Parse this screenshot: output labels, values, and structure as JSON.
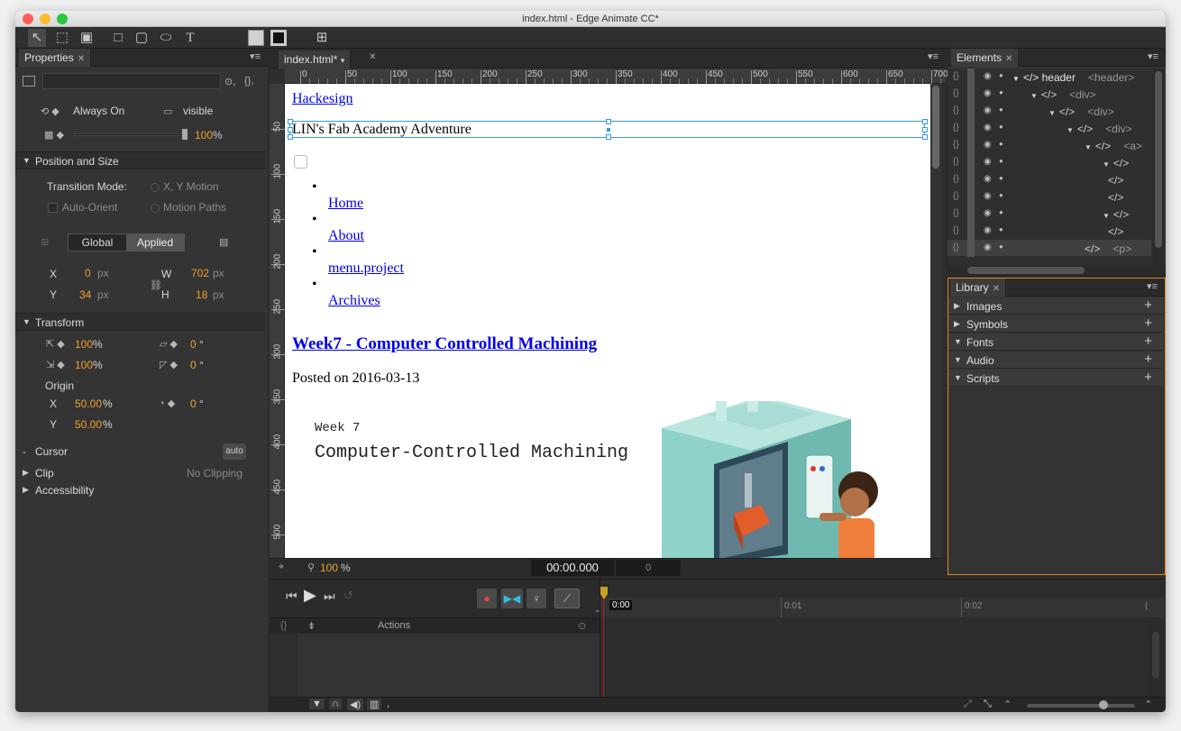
{
  "window": {
    "title": "index.html - Edge Animate CC*"
  },
  "toolbar": {
    "tools": [
      "selection-tool",
      "transform-tool",
      "clipping-tool",
      "rectangle-tool",
      "rounded-rectangle-tool",
      "ellipse-tool",
      "text-tool"
    ],
    "text_tool_glyph": "T"
  },
  "properties": {
    "tab": "Properties",
    "always_on": "Always On",
    "visible": "visible",
    "opacity": "100",
    "opacity_unit": "%",
    "position_size_section": "Position and Size",
    "transition_mode_label": "Transition Mode:",
    "xy_motion": "X, Y Motion",
    "auto_orient": "Auto-Orient",
    "motion_paths": "Motion Paths",
    "global": "Global",
    "applied": "Applied",
    "x_label": "X",
    "x_value": "0",
    "x_unit": "px",
    "y_label": "Y",
    "y_value": "34",
    "y_unit": "px",
    "w_label": "W",
    "w_value": "702",
    "w_unit": "px",
    "h_label": "H",
    "h_value": "18",
    "h_unit": "px",
    "transform_section": "Transform",
    "scale_x": "100",
    "scale_y": "100",
    "pct": "%",
    "skew_1": "0",
    "skew_2": "0",
    "deg": "°",
    "origin_label": "Origin",
    "origin_x_label": "X",
    "origin_x": "50.00",
    "origin_y_label": "Y",
    "origin_y": "50.00",
    "rotate": "0",
    "cursor_section": "Cursor",
    "cursor_value": "auto",
    "clip_section": "Clip",
    "clip_value": "No Clipping",
    "accessibility_section": "Accessibility"
  },
  "stage": {
    "tab": "index.html*",
    "ruler_h": [
      "0",
      "50",
      "100",
      "150",
      "200",
      "250",
      "300",
      "350",
      "400",
      "450",
      "500",
      "550",
      "600",
      "650",
      "700"
    ],
    "ruler_v": [
      "50",
      "100",
      "150",
      "200",
      "250",
      "300",
      "350",
      "400",
      "450",
      "500"
    ],
    "zoom": "100",
    "zoom_unit": "%",
    "time": "00:00.000",
    "frame": "0"
  },
  "page": {
    "site_link": "Hackesign",
    "tagline": "LIN's Fab Academy Adventure",
    "nav": [
      "Home",
      "About",
      "menu.project",
      "Archives"
    ],
    "post_title": "Week7 - Computer Controlled Machining",
    "posted_on": "Posted on 2016-03-13",
    "banner_week": "Week 7",
    "banner_title": "Computer-Controlled Machining"
  },
  "elements": {
    "tab": "Elements",
    "rows": [
      {
        "label": "</>  header",
        "tag": "<header>"
      },
      {
        "label": "</>",
        "tag": "<div>"
      },
      {
        "label": "</>",
        "tag": "<div>"
      },
      {
        "label": "</>",
        "tag": "<div>"
      },
      {
        "label": "</>",
        "tag": "<a>"
      },
      {
        "label": "</>",
        "tag": ""
      },
      {
        "label": "</>",
        "tag": ""
      },
      {
        "label": "</>",
        "tag": ""
      },
      {
        "label": "</>",
        "tag": ""
      },
      {
        "label": "</>",
        "tag": ""
      },
      {
        "label": "</>",
        "tag": "<p>"
      }
    ]
  },
  "library": {
    "tab": "Library",
    "sections": [
      "Images",
      "Symbols",
      "Fonts",
      "Audio",
      "Scripts"
    ]
  },
  "timeline": {
    "actions_label": "Actions",
    "time_marker": "0:00",
    "ticks": [
      "0:01",
      "0:02"
    ]
  },
  "colors": {
    "accent": "#f0a02c",
    "link": "#0000ee",
    "selection": "#3a9ad9"
  }
}
